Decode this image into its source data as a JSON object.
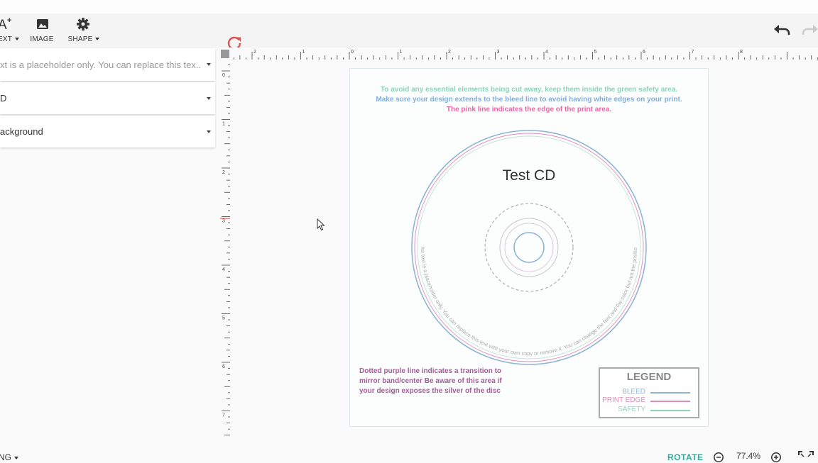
{
  "toolbar": {
    "text_label": "EXT",
    "image_label": "IMAGE",
    "shape_label": "SHAPE"
  },
  "panels": [
    {
      "text": "xt is a placeholder only. You can replace this tex...",
      "placeholder": true
    },
    {
      "text": "D",
      "placeholder": false
    },
    {
      "text": "ackground",
      "placeholder": false
    }
  ],
  "ruler": {
    "top_labels": [
      "2",
      "1",
      "0",
      "1",
      "2",
      "3",
      "4",
      "5",
      "6",
      "7",
      "8"
    ],
    "left_labels": [
      "0",
      "1",
      "2",
      "3",
      "4",
      "5",
      "6",
      "7"
    ]
  },
  "canvas": {
    "note_green": "To avoid any essential elements being cut away, keep them inside the green safety area.",
    "note_blue": "Make sure your design extends to the bleed line to avoid having white edges on your print.",
    "note_pink": "The pink line indicates the edge of the print area.",
    "cd_title": "Test CD",
    "curved_text": "This text is a placeholder only. You can replace this text with your own copy or remove it. You can change the font and the color but not the position.",
    "purple_note_lines": [
      "Dotted purple line indicates a transition to",
      "mirror band/center Be aware of this area if",
      "your design exposes the silver of the disc"
    ]
  },
  "legend": {
    "title": "LEGEND",
    "items": [
      {
        "label": "BLEED",
        "color": "#8fb4d6"
      },
      {
        "label": "PRINT EDGE",
        "color": "#e38ab8"
      },
      {
        "label": "SAFETY",
        "color": "#8fd3b9"
      }
    ]
  },
  "colors": {
    "green": "#8fd3b9",
    "blue": "#86aedb",
    "pink": "#e66aa6",
    "purple_dotted": "#aaaaaa",
    "accent": "#2bb0a0",
    "refresh": "#d9534f"
  },
  "bottom": {
    "left_label": "NG",
    "rotate_label": "ROTATE",
    "zoom_level": "77.4%"
  },
  "icons": {
    "text": "text-icon",
    "image": "image-icon",
    "shape": "gear-icon",
    "refresh": "refresh-icon",
    "undo": "undo-icon",
    "redo": "redo-icon",
    "zoom_out": "zoom-out-icon",
    "zoom_in": "zoom-in-icon",
    "fullscreen": "fullscreen-icon"
  }
}
